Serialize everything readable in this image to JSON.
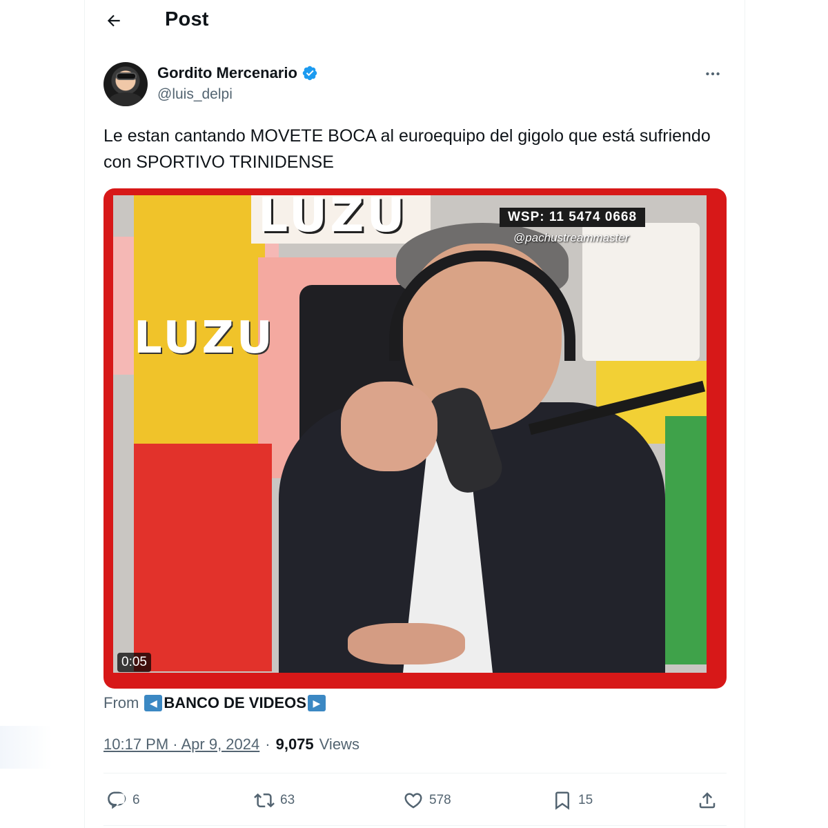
{
  "header": {
    "title": "Post"
  },
  "author": {
    "name": "Gordito Mercenario",
    "handle": "@luis_delpi",
    "verified": true
  },
  "post": {
    "text": "Le estan cantando MOVETE BOCA al euroequipo del gigolo que está sufriendo con SPORTIVO TRINIDENSE"
  },
  "media": {
    "type": "video",
    "duration": "0:05",
    "overlay_phone": "WSP: 11 5474 0668",
    "overlay_handle": "@pachustreammaster",
    "logo_text": "LUZU"
  },
  "attribution": {
    "from_label": "From",
    "source": "BANCO DE VIDEOS"
  },
  "meta": {
    "timestamp": "10:17 PM · Apr 9, 2024",
    "separator": "·",
    "views_count": "9,075",
    "views_label": "Views"
  },
  "actions": {
    "replies": "6",
    "reposts": "63",
    "likes": "578",
    "bookmarks": "15"
  },
  "colors": {
    "accent": "#1d9bf0",
    "text_primary": "#0f1419",
    "text_secondary": "#536471",
    "media_frame": "#d71818"
  },
  "icons": {
    "back": "arrow-left-icon",
    "verified": "verified-badge-icon",
    "more": "more-horizontal-icon",
    "reply": "reply-icon",
    "repost": "repost-icon",
    "like": "heart-icon",
    "bookmark": "bookmark-icon",
    "share": "share-icon"
  }
}
